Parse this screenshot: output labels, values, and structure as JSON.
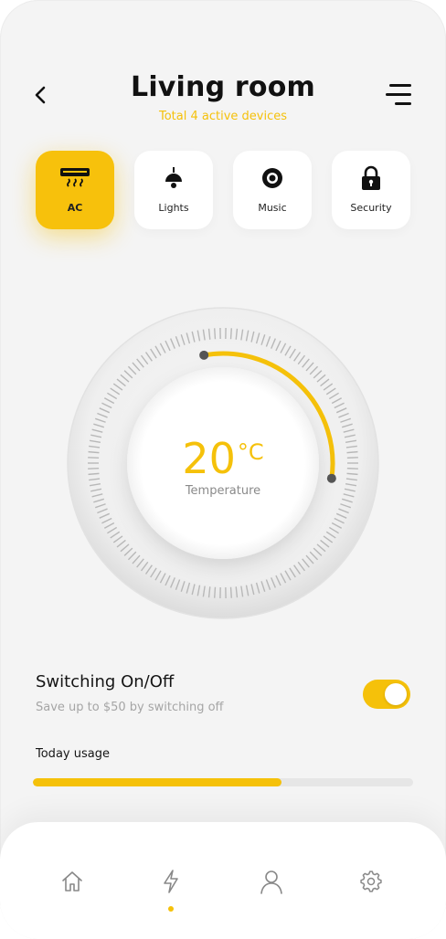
{
  "header": {
    "title": "Living room",
    "subtitle": "Total 4 active devices"
  },
  "icons": {
    "back": "chevron-left-icon",
    "menu": "menu-icon"
  },
  "devices": [
    {
      "label": "AC",
      "icon": "air-conditioner-icon",
      "active": true
    },
    {
      "label": "Lights",
      "icon": "ceiling-lamp-icon",
      "active": false
    },
    {
      "label": "Music",
      "icon": "speaker-icon",
      "active": false
    },
    {
      "label": "Security",
      "icon": "lock-icon",
      "active": false
    }
  ],
  "thermostat": {
    "value": "20",
    "unit": "°C",
    "label": "Temperature",
    "arc_fraction": 0.3
  },
  "switching": {
    "title": "Switching On/Off",
    "subtitle": "Save up to $50 by switching off",
    "enabled": true
  },
  "usage": {
    "label": "Today usage",
    "fraction": 0.655
  },
  "tabbar": {
    "tabs": [
      {
        "icon": "home-icon",
        "active": false
      },
      {
        "icon": "lightning-icon",
        "active": true
      },
      {
        "icon": "user-icon",
        "active": false
      },
      {
        "icon": "settings-gear-icon",
        "active": false
      }
    ]
  },
  "colors": {
    "accent": "#f5c10a",
    "background": "#f4f4f4",
    "text": "#111111",
    "muted": "#a5a5a5"
  }
}
